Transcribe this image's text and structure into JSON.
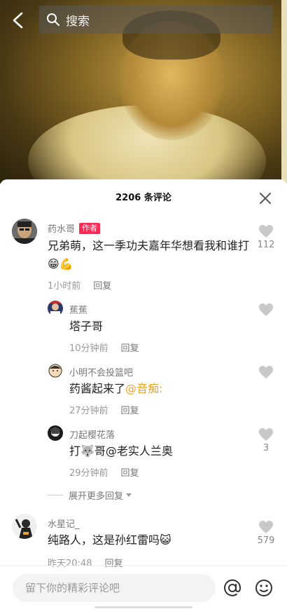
{
  "search": {
    "placeholder": "搜索"
  },
  "comments_header": {
    "title": "2206 条评论"
  },
  "comments": [
    {
      "name": "药水哥",
      "badge": "作者",
      "text": "兄弟萌，这一季功夫嘉年华想看我和谁打😁💪",
      "time": "1小时前",
      "reply": "回复",
      "likes": "112"
    },
    {
      "name": "水星记_",
      "text": "纯路人，这是孙红雷吗😺",
      "time": "昨天20:48",
      "reply": "回复",
      "likes": "579"
    }
  ],
  "replies": [
    {
      "name": "蕉蕉",
      "text": "塔子哥",
      "time": "10分钟前",
      "reply": "回复",
      "likes": ""
    },
    {
      "name": "小明不会投篮吧",
      "text": "药酱起来了",
      "mention": "@音痴:",
      "time": "27分钟前",
      "reply": "回复",
      "likes": ""
    },
    {
      "name": "刀起樱花落",
      "text": "打🐺哥@老实人兰奥",
      "time": "29分钟前",
      "reply": "回复",
      "likes": "3"
    }
  ],
  "expand_label": "展开更多回复",
  "input": {
    "placeholder": "留下你的精彩评论吧"
  },
  "colors": {
    "accent": "#fe2c55",
    "mention": "#e8a32a"
  }
}
